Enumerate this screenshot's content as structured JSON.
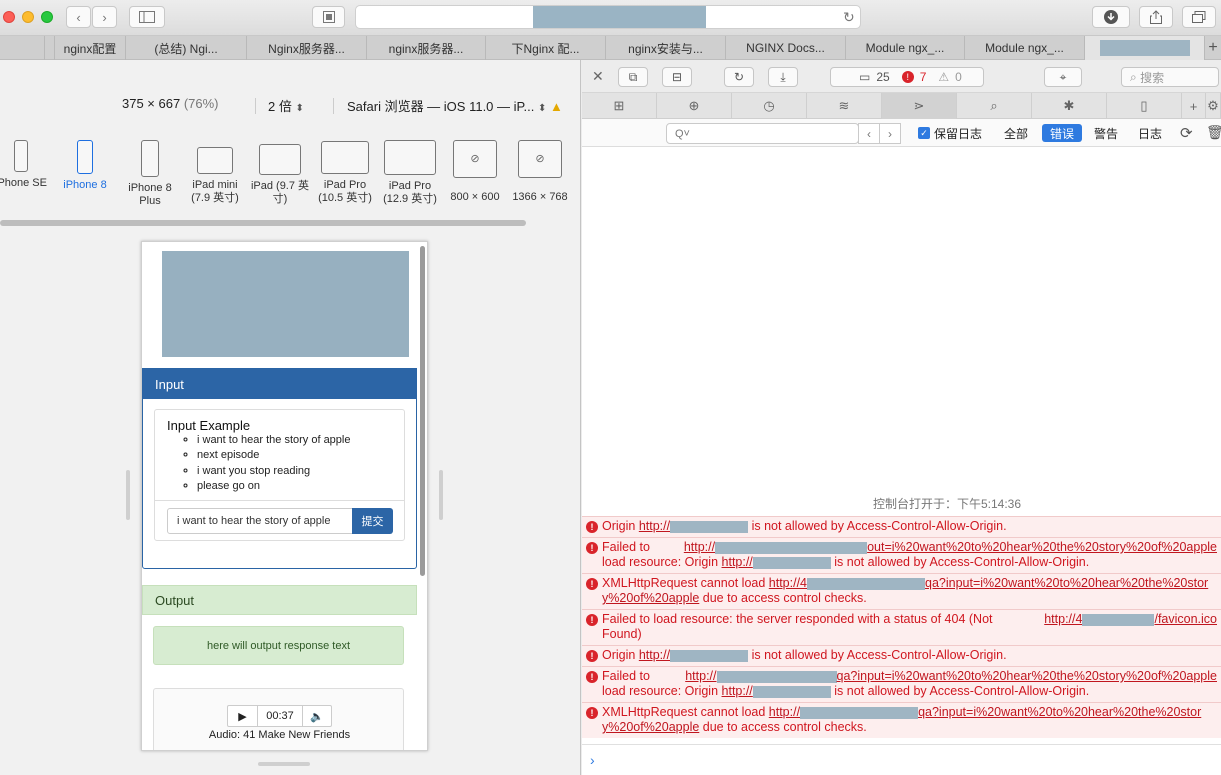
{
  "browser": {
    "tabs": [
      "nginx配置",
      "(总结) Ngi...",
      "Nginx服务器...",
      "nginx服务器...",
      "下Nginx 配...",
      "nginx安装与...",
      "NGINX Docs...",
      "Module ngx_...",
      "Module ngx_..."
    ],
    "new_tab": "+"
  },
  "responsive": {
    "size": "375 × 667",
    "scale": "(76%)",
    "pixel_ratio": "2 倍",
    "user_agent": "Safari 浏览器 — iOS 11.0 — iP...",
    "devices": [
      {
        "label": "iPhone SE"
      },
      {
        "label": "iPhone 8"
      },
      {
        "label": "iPhone 8 Plus"
      },
      {
        "label": "iPad mini (7.9 英寸)"
      },
      {
        "label": "iPad (9.7 英寸)"
      },
      {
        "label": "iPad Pro (10.5 英寸)"
      },
      {
        "label": "iPad Pro (12.9 英寸)"
      },
      {
        "label": "800 × 600"
      },
      {
        "label": "1366 × 768"
      }
    ]
  },
  "page": {
    "input_title": "Input",
    "example_title": "Input Example",
    "examples": [
      "i want to hear the story of apple",
      "next episode",
      "i want you stop reading",
      "please go on"
    ],
    "input_value": "i want to hear the story of apple",
    "submit_label": "提交",
    "output_title": "Output",
    "output_text": "here will output response text",
    "audio_time": "00:37",
    "audio_caption": "Audio: 41 Make New Friends"
  },
  "inspector": {
    "resource_count": "25",
    "error_count": "7",
    "warning_count": "0",
    "search_placeholder": "搜索",
    "filter_placeholder": "Q˅",
    "preserve_log": "保留日志",
    "filters": [
      "全部",
      "错误",
      "警告",
      "日志"
    ],
    "console_opened": "控制台打开于：下午5:14:36",
    "logs": [
      {
        "a": "Origin ",
        "link": "http://",
        "b": " is not allowed by Access-Control-Allow-Origin."
      },
      {
        "a": "Failed to load resource: Origin ",
        "link1": "http://",
        "tail1": "out=i%20want%20to%20hear%20the%20story%20of%20apple",
        "link": "http://",
        "b": " is not allowed by Access-Control-Allow-Origin."
      },
      {
        "a": "XMLHttpRequest cannot load ",
        "link": "http://4",
        "tail": "qa?input=i%20want%20to%20hear%20the%20story%20of%20apple",
        "b": " due to access control checks."
      },
      {
        "a": "Failed to load resource: the server responded with a status of 404 (Not Found)",
        "link": "http://4",
        "tail": "/favicon.ico"
      },
      {
        "a": "Origin ",
        "link": "http://",
        "b": " is not allowed by Access-Control-Allow-Origin."
      },
      {
        "a": "Failed to load resource: Origin ",
        "link1": "http://",
        "tail1": "qa?input=i%20want%20to%20hear%20the%20story%20of%20apple",
        "link": "http://",
        "b": " is not allowed by Access-Control-Allow-Origin."
      },
      {
        "a": "XMLHttpRequest cannot load ",
        "link": "http://",
        "tail": "qa?input=i%20want%20to%20hear%20the%20story%20of%20apple",
        "b": " due to access control checks."
      }
    ],
    "prompt": "›"
  }
}
